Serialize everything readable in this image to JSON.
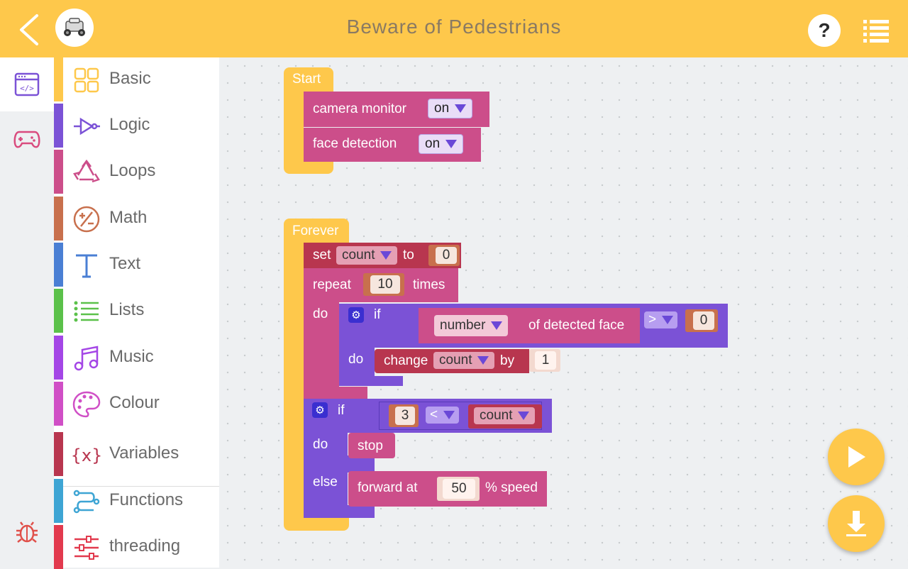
{
  "header": {
    "title": "Beware of Pedestrians",
    "help_label": "?"
  },
  "rail": {
    "items": [
      "code-icon",
      "gamepad-icon",
      "bug-icon"
    ]
  },
  "categories": [
    {
      "label": "Basic",
      "color": "#fec84b",
      "icon": "grid-icon"
    },
    {
      "label": "Logic",
      "color": "#7b52d6",
      "icon": "logic-gate-icon"
    },
    {
      "label": "Loops",
      "color": "#cc4e8a",
      "icon": "recycle-icon"
    },
    {
      "label": "Math",
      "color": "#c8704d",
      "icon": "plus-minus-icon"
    },
    {
      "label": "Text",
      "color": "#4a7fd4",
      "icon": "text-icon"
    },
    {
      "label": "Lists",
      "color": "#5bc14a",
      "icon": "list-icon"
    },
    {
      "label": "Music",
      "color": "#a446e6",
      "icon": "music-icon"
    },
    {
      "label": "Colour",
      "color": "#d04fc6",
      "icon": "palette-icon"
    },
    {
      "label": "Variables",
      "color": "#b8364f",
      "icon": "variable-icon"
    },
    {
      "label": "Functions",
      "color": "#3ea5d4",
      "icon": "function-icon"
    },
    {
      "label": "threading",
      "color": "#e23a4e",
      "icon": "sliders-icon"
    }
  ],
  "blocks": {
    "start": {
      "hat": "Start",
      "camera_monitor": "camera monitor",
      "camera_value": "on",
      "face_detection": "face detection",
      "face_value": "on"
    },
    "forever": {
      "hat": "Forever",
      "set": "set",
      "set_var": "count",
      "to": "to",
      "set_value": "0",
      "repeat": "repeat",
      "repeat_times": "10",
      "times": "times",
      "do": "do",
      "if": "if",
      "number": "number",
      "of_detected_face": "of detected face",
      "gt": ">",
      "compare_value": "0",
      "do2": "do",
      "change": "change",
      "change_var": "count",
      "by": "by",
      "change_value": "1",
      "if2": "if",
      "lt_left": "3",
      "lt": "<",
      "lt_var": "count",
      "do3": "do",
      "stop": "stop",
      "else": "else",
      "forward_at": "forward at",
      "speed_value": "50",
      "speed_label": "% speed"
    }
  },
  "colors": {
    "header": "#fec84b",
    "event": "#fec84b",
    "loops": "#cc4e8a",
    "logic": "#7b52d6",
    "variables": "#b8364f",
    "math": "#c8704d"
  }
}
